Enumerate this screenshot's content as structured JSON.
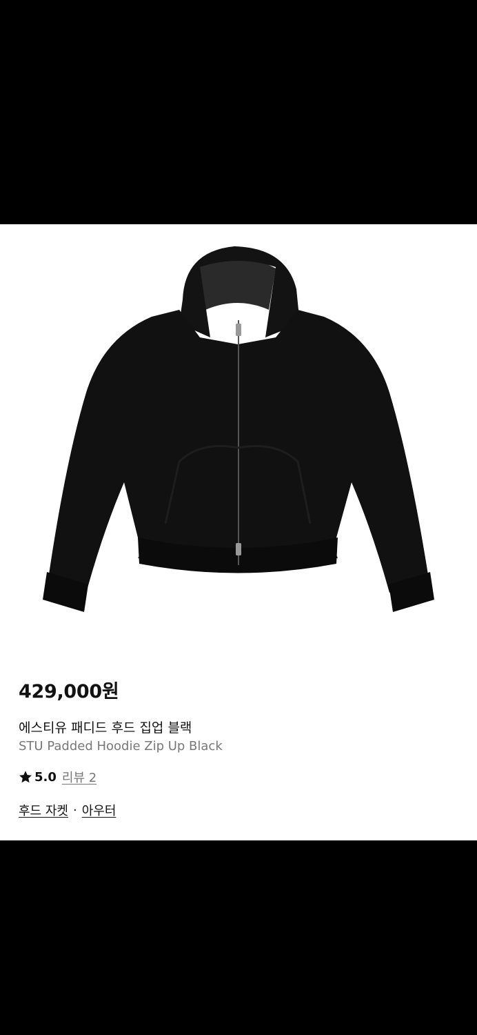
{
  "product": {
    "price": "429,000원",
    "name_ko": "에스티유 패디드 후드 집업 블랙",
    "name_en": "STU Padded Hoodie Zip Up Black",
    "rating": "5.0",
    "review_label": "리뷰 2",
    "categories": [
      "후드 자켓",
      "아우터"
    ],
    "category_separator": "·",
    "image_icon": "black-padded-hoodie-jacket-image",
    "colors": {
      "jacket": "#111111",
      "background": "#ffffff",
      "frame": "#000000",
      "muted_text": "#777777"
    }
  }
}
